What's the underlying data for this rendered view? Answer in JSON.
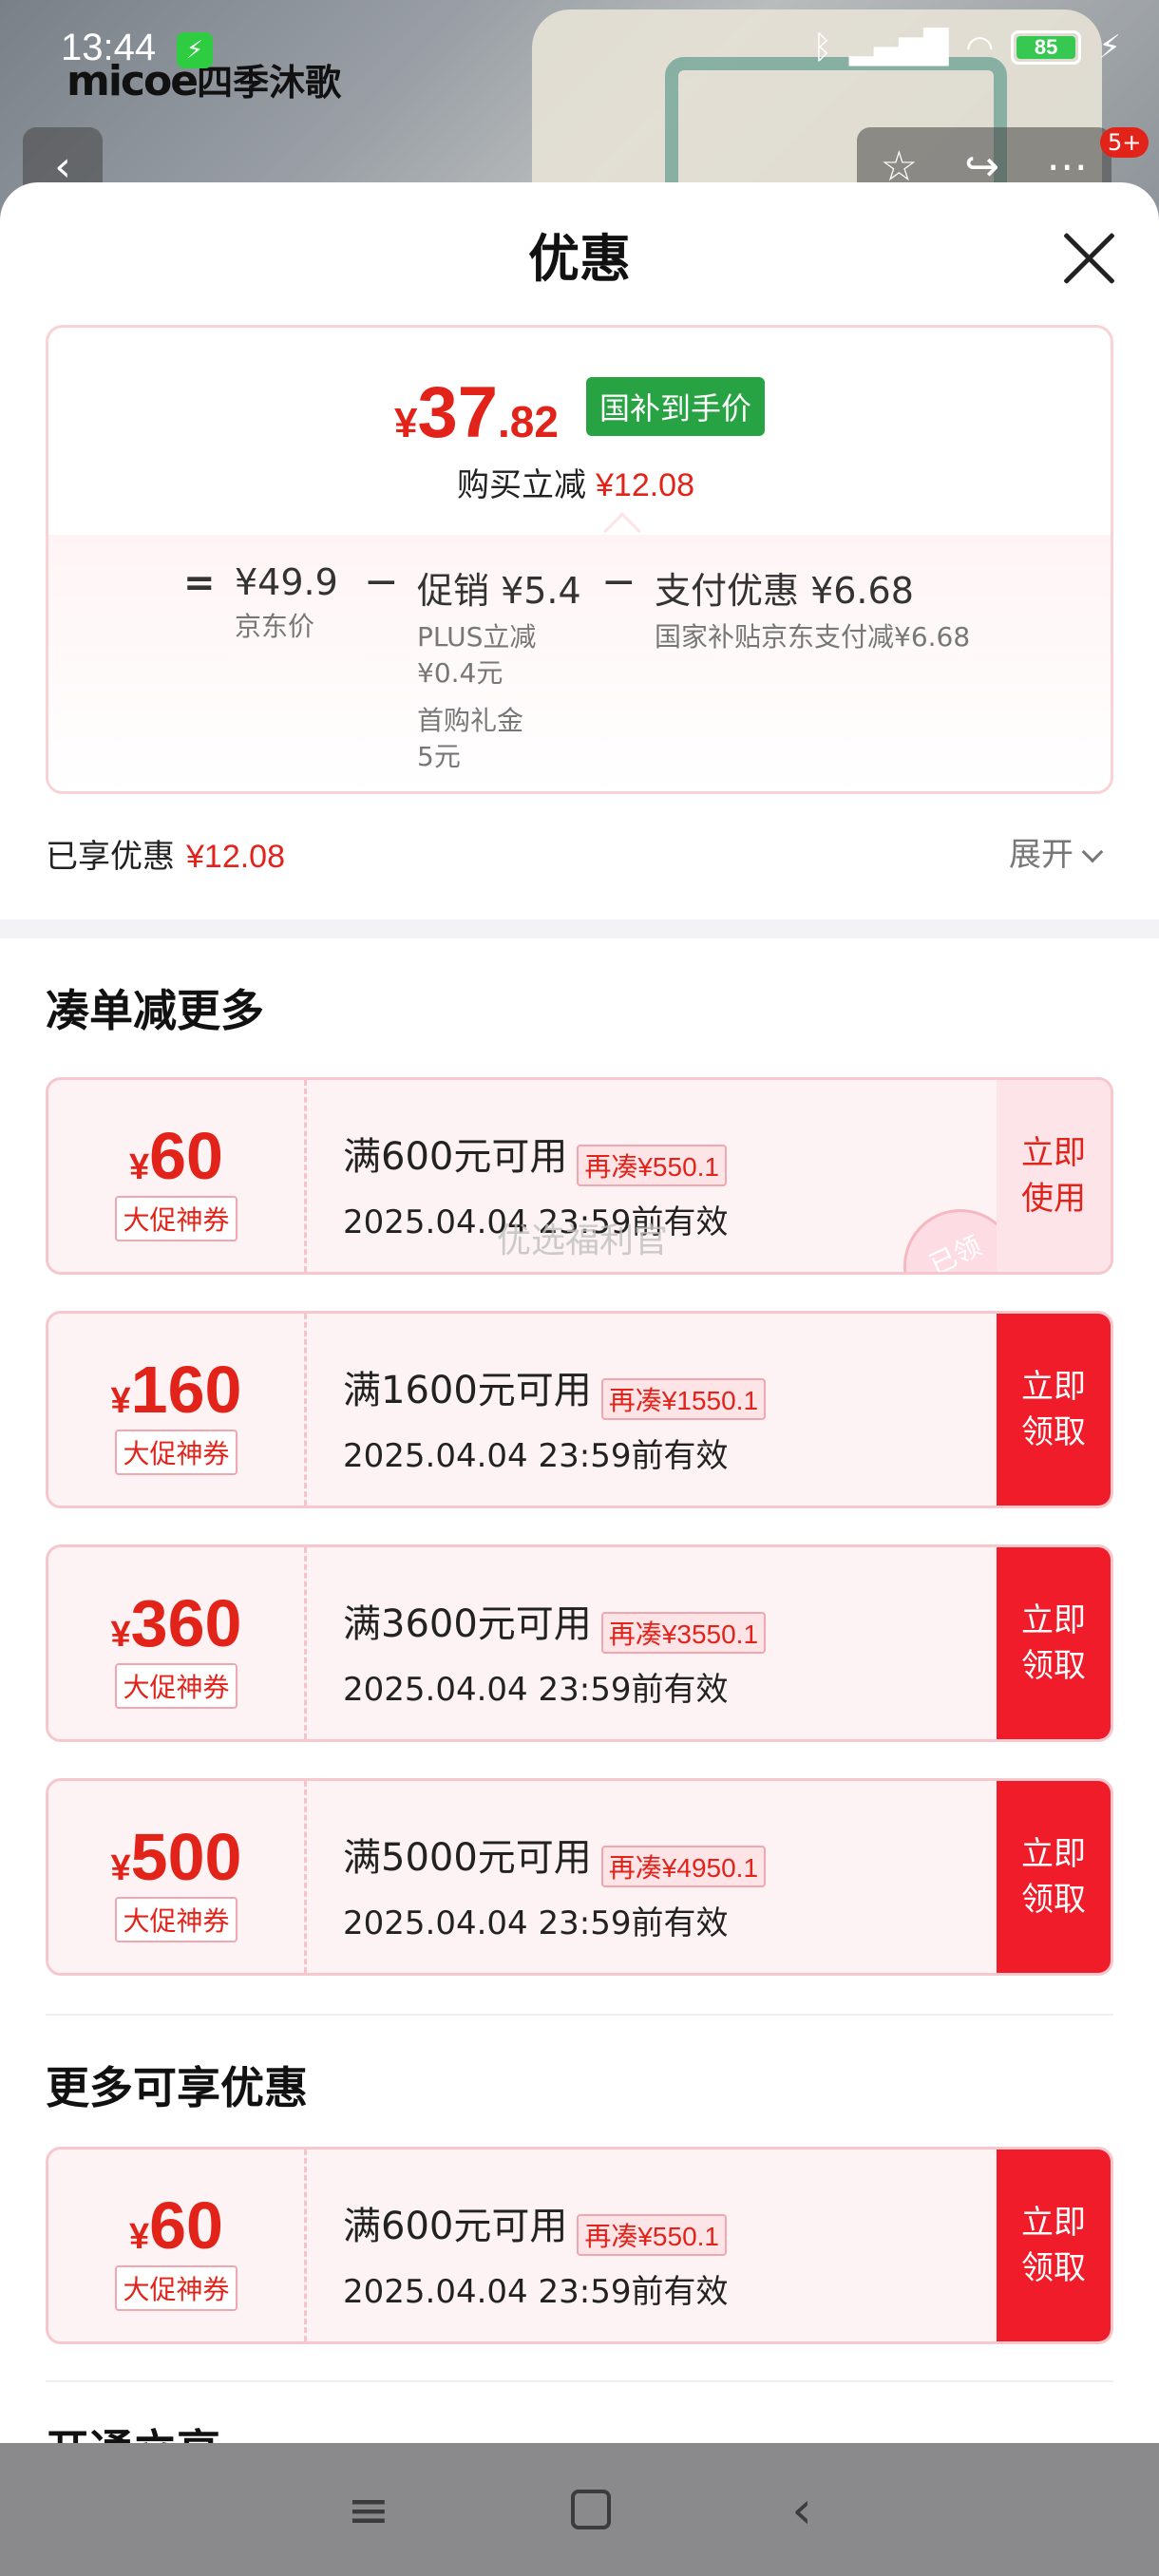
{
  "status_bar": {
    "time": "13:44",
    "battery": "85",
    "icons": [
      "charging-icon",
      "bluetooth-icon",
      "signal-icon",
      "wifi-icon",
      "battery-icon"
    ]
  },
  "background": {
    "brand": "micoe",
    "brand_cn": "四季沐歌",
    "cart_badge": "5+"
  },
  "sheet": {
    "title": "优惠",
    "price": {
      "symbol": "¥",
      "integer": "37",
      "decimal": ".82",
      "tag": "国补到手价",
      "buy_label": "购买立减",
      "buy_value": "¥12.08"
    },
    "breakdown": {
      "equals": "=",
      "jd_price": "¥49.9",
      "jd_label": "京东价",
      "minus1": "−",
      "promo": "促销 ¥5.4",
      "promo_sub1": "PLUS立减",
      "promo_sub1_val": "¥0.4元",
      "promo_sub2": "首购礼金",
      "promo_sub2_val": "5元",
      "minus2": "−",
      "pay": "支付优惠 ¥6.68",
      "pay_sub": "国家补贴京东支付减¥6.68"
    },
    "enjoyed_label": "已享优惠",
    "enjoyed_value": "¥12.08",
    "expand_label": "展开",
    "section1_title": "凑单减更多",
    "coupons": [
      {
        "symbol": "¥",
        "amount": "60",
        "tag": "大促神券",
        "condition": "满600元可用",
        "more": "再凑¥550.1",
        "date": "2025.04.04 23:59前有效",
        "button_line1": "立即",
        "button_line2": "使用",
        "stamp": "已领",
        "watermark": "优选福利官"
      },
      {
        "symbol": "¥",
        "amount": "160",
        "tag": "大促神券",
        "condition": "满1600元可用",
        "more": "再凑¥1550.1",
        "date": "2025.04.04 23:59前有效",
        "button_line1": "立即",
        "button_line2": "领取"
      },
      {
        "symbol": "¥",
        "amount": "360",
        "tag": "大促神券",
        "condition": "满3600元可用",
        "more": "再凑¥3550.1",
        "date": "2025.04.04 23:59前有效",
        "button_line1": "立即",
        "button_line2": "领取"
      },
      {
        "symbol": "¥",
        "amount": "500",
        "tag": "大促神券",
        "condition": "满5000元可用",
        "more": "再凑¥4950.1",
        "date": "2025.04.04 23:59前有效",
        "button_line1": "立即",
        "button_line2": "领取"
      }
    ],
    "section2_title": "更多可享优惠",
    "more_coupon": {
      "symbol": "¥",
      "amount": "60",
      "tag": "大促神券",
      "condition": "满600元可用",
      "more": "再凑¥550.1",
      "date": "2025.04.04 23:59前有效",
      "button_line1": "立即",
      "button_line2": "领取"
    },
    "section3_title_partial": "开通立享"
  },
  "colors": {
    "accent_red": "#e2231a",
    "button_red": "#f01c2a",
    "green_tag": "#27a344"
  }
}
